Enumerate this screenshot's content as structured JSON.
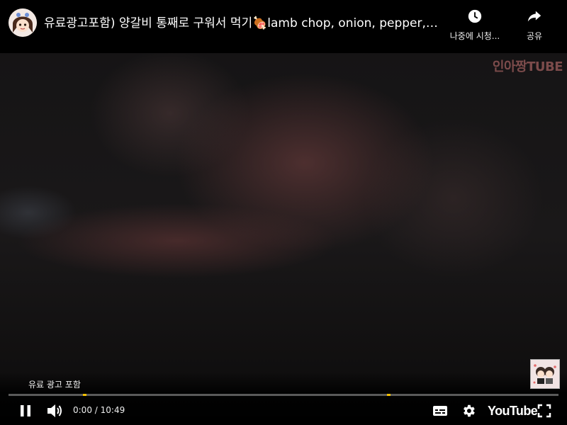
{
  "video": {
    "title": "유료광고포함) 양갈비 통째로 구워서 먹기🍖lamb chop, onion, pepper, mu...",
    "watermark": "인아짱TUBE"
  },
  "header": {
    "watch_later_label": "나중에 시청...",
    "share_label": "공유"
  },
  "overlay": {
    "paid_promotion_label": "유료 광고 포함"
  },
  "player": {
    "current_time": "0:00",
    "separator": " / ",
    "duration": "10:49",
    "progress_fraction": 0,
    "ad_markers_fraction": [
      0.135,
      0.688
    ],
    "logo_text": "YouTube"
  },
  "icons": {
    "watch_later": "clock-icon",
    "share": "share-arrow-icon",
    "pause": "pause-icon",
    "volume": "volume-icon",
    "subtitles": "subtitles-icon",
    "settings": "gear-icon",
    "fullscreen": "fullscreen-icon"
  },
  "colors": {
    "ad_marker": "#f4c000",
    "background": "#000000"
  }
}
